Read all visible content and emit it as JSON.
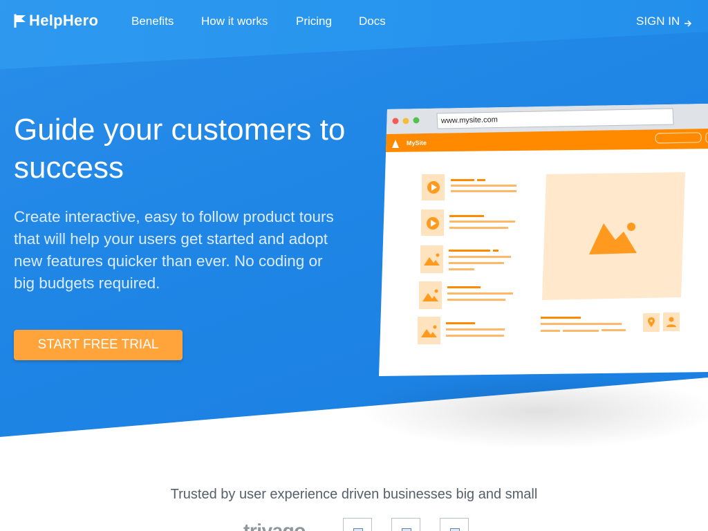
{
  "brand": {
    "name": "HelpHero",
    "icon": "flag-icon"
  },
  "nav": {
    "links": [
      "Benefits",
      "How it works",
      "Pricing",
      "Docs"
    ],
    "sign_in": "SIGN IN",
    "sign_in_icon": "arrow-right-icon"
  },
  "hero": {
    "title": "Guide your customers to success",
    "subtitle": "Create interactive, easy to follow product tours that will help your users get started and adopt new features quicker than ever. No coding or big budgets required.",
    "cta": "START FREE TRIAL"
  },
  "mockup": {
    "url": "www.mysite.com",
    "site_name": "MySite"
  },
  "trusted": {
    "heading": "Trusted by user experience driven businesses big and small",
    "brand_text": "trivago"
  },
  "colors": {
    "primary": "#1f86e6",
    "accent": "#ffa43a",
    "mock_orange": "#ff8a00",
    "mock_light": "#ffe8cc"
  }
}
